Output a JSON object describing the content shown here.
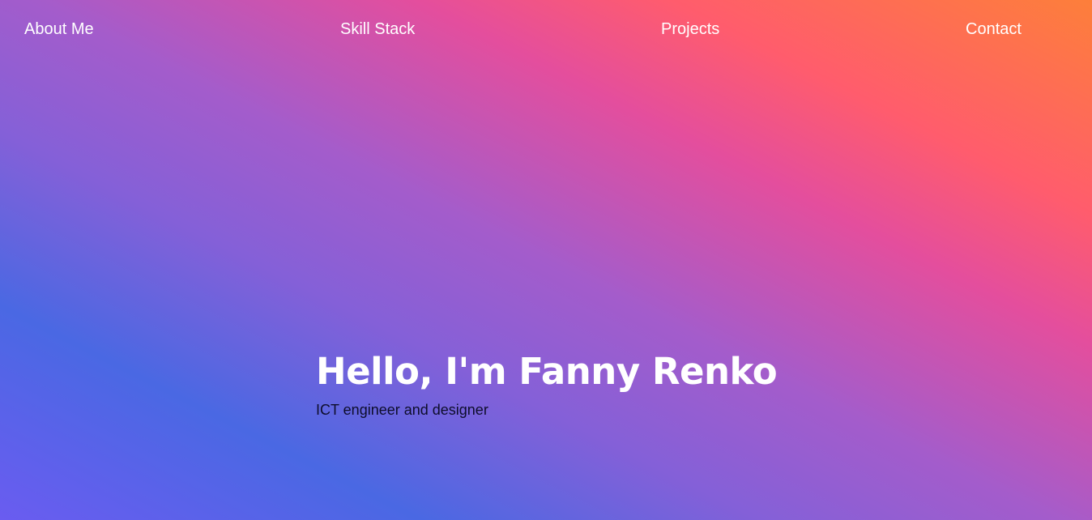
{
  "nav": {
    "items": [
      {
        "label": "About Me"
      },
      {
        "label": "Skill Stack"
      },
      {
        "label": "Projects"
      },
      {
        "label": "Contact"
      }
    ]
  },
  "hero": {
    "title": "Hello, I'm Fanny Renko",
    "subtitle": "ICT engineer and designer"
  },
  "colors": {
    "gradient": [
      "#6a5cf0",
      "#4a68e3",
      "#a45ccb",
      "#e44e9d",
      "#ff5c6d",
      "#fd7f3a"
    ],
    "nav_text": "#ffffff",
    "title_text": "#ffffff",
    "subtitle_text": "#0d0d2a"
  }
}
